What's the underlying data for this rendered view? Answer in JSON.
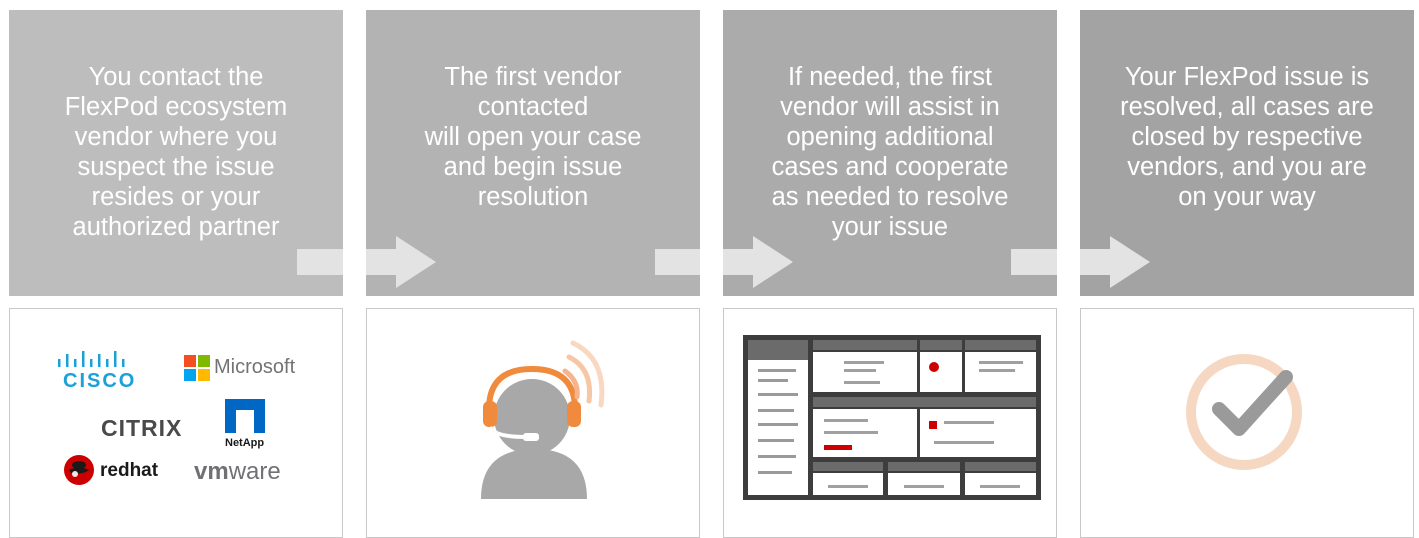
{
  "steps": [
    {
      "text": "You contact the\nFlexPod ecosystem\nvendor where you\nsuspect the issue\nresides or your\nauthorized partner",
      "color": "#bdbdbd"
    },
    {
      "text": "The first vendor\ncontacted\nwill open your case\nand begin issue\nresolution",
      "color": "#b3b3b3"
    },
    {
      "text": "If needed, the first\nvendor will assist in\nopening additional\ncases and cooperate\nas needed to resolve\nyour issue",
      "color": "#ababab"
    },
    {
      "text": "Your FlexPod issue is\nresolved, all cases are\nclosed by respective\nvendors, and you are\non your way",
      "color": "#a3a3a3"
    }
  ],
  "logos": {
    "cisco": "cisco",
    "microsoft": "Microsoft",
    "citrix": "CITRIX",
    "netapp": "NetApp",
    "redhat": "redhat",
    "vmware_vm": "vm",
    "vmware_ware": "ware"
  },
  "colors": {
    "arrow": "#e3e3e3",
    "headset_orange": "#f08a3c",
    "person_gray": "#a8a8a8",
    "check_ring": "#f6d7c2",
    "check_mark": "#9a9a9a",
    "cisco_blue": "#1ba0d7",
    "redhat_red": "#cc0000"
  }
}
